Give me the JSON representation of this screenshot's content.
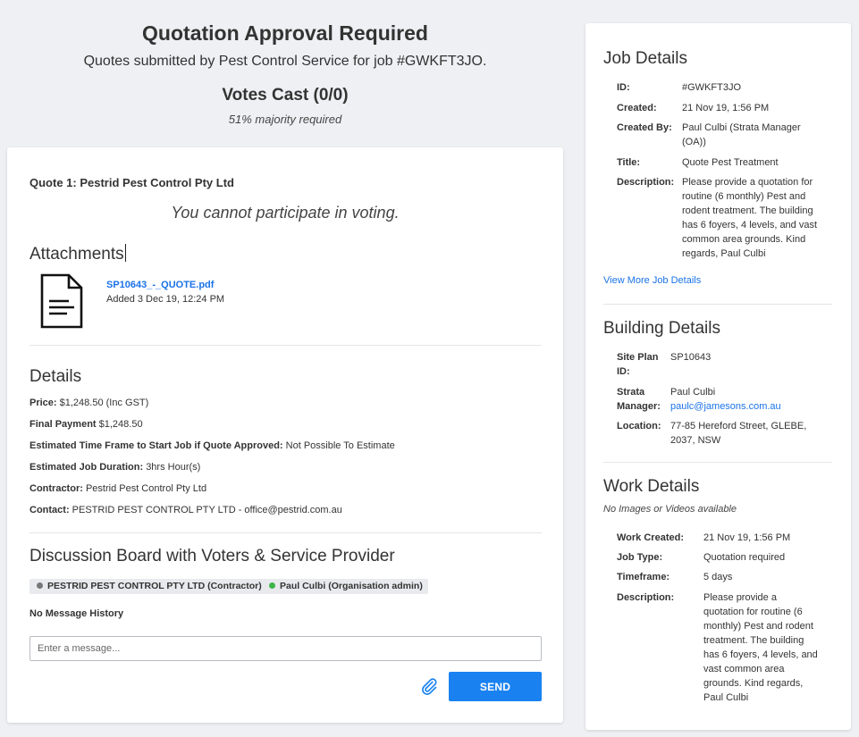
{
  "header": {
    "title": "Quotation Approval Required",
    "subtitle": "Quotes submitted by Pest Control Service for job #GWKFT3JO.",
    "votes": "Votes Cast (0/0)",
    "majority": "51% majority required"
  },
  "quote": {
    "title": "Quote 1: Pestrid Pest Control Pty Ltd",
    "voting_notice": "You cannot participate in voting.",
    "attachments_heading": "Attachments",
    "attachment": {
      "file_name": "SP10643_-_QUOTE.pdf",
      "added": "Added 3 Dec 19, 12:24 PM"
    },
    "details_heading": "Details",
    "details": [
      {
        "label": "Price:",
        "value": "$1,248.50 (Inc GST)"
      },
      {
        "label": "Final Payment",
        "value": "$1,248.50"
      },
      {
        "label": "Estimated Time Frame to Start Job if Quote Approved:",
        "value": "Not Possible To Estimate"
      },
      {
        "label": "Estimated Job Duration:",
        "value": "3hrs Hour(s)"
      },
      {
        "label": "Contractor:",
        "value": "Pestrid Pest Control Pty Ltd"
      },
      {
        "label": "Contact:",
        "value": "PESTRID PEST CONTROL PTY LTD - office@pestrid.com.au"
      }
    ],
    "discussion_heading": "Discussion Board with Voters & Service Provider",
    "participants": [
      {
        "label": "PESTRID PEST CONTROL PTY LTD (Contractor)",
        "status_color": "#777777"
      },
      {
        "label": "Paul Culbi (Organisation admin)",
        "status_color": "#3cb54a"
      }
    ],
    "no_messages": "No Message History",
    "message_placeholder": "Enter a message...",
    "send_label": "SEND",
    "attach_icon": "paperclip-icon"
  },
  "sidebar": {
    "job_heading": "Job Details",
    "job": [
      {
        "label": "ID:",
        "value": "#GWKFT3JO"
      },
      {
        "label": "Created:",
        "value": "21 Nov 19, 1:56 PM"
      },
      {
        "label": "Created By:",
        "value": "Paul Culbi (Strata Manager (OA))"
      },
      {
        "label": "Title:",
        "value": "Quote Pest Treatment"
      },
      {
        "label": "Description:",
        "value": "Please provide a quotation for routine (6 monthly) Pest and rodent treatment. The building has 6 foyers, 4 levels, and vast common area grounds. Kind regards, Paul Culbi"
      }
    ],
    "view_more": "View More Job Details",
    "building_heading": "Building Details",
    "building": [
      {
        "label": "Site Plan ID:",
        "value": "SP10643"
      },
      {
        "label": "Strata Manager:",
        "value": "Paul Culbi",
        "email": "paulc@jamesons.com.au"
      },
      {
        "label": "Location:",
        "value": "77-85 Hereford Street, GLEBE, 2037, NSW"
      }
    ],
    "work_heading": "Work Details",
    "no_media": "No Images or Videos available",
    "work": [
      {
        "label": "Work Created:",
        "value": "21 Nov 19, 1:56 PM"
      },
      {
        "label": "Job Type:",
        "value": "Quotation required"
      },
      {
        "label": "Timeframe:",
        "value": "5 days"
      },
      {
        "label": "Description:",
        "value": "Please provide a quotation for routine (6 monthly) Pest and rodent treatment. The building has 6 foyers, 4 levels, and vast common area grounds. Kind regards, Paul Culbi"
      }
    ]
  },
  "colors": {
    "accent": "#1a82f0",
    "link": "#1a73e8",
    "background": "#eef0f3"
  }
}
